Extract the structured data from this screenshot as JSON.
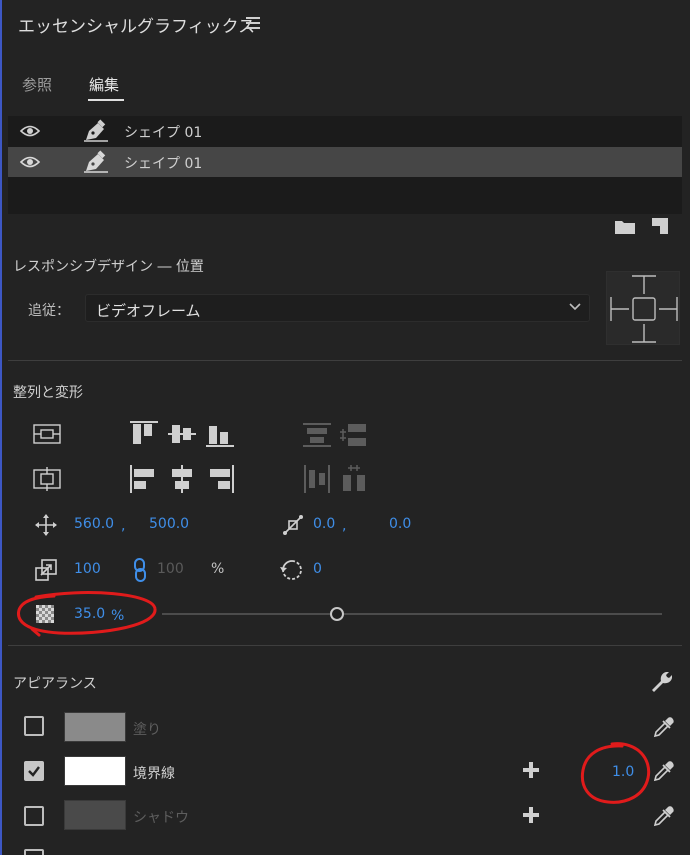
{
  "panel": {
    "title": "エッセンシャルグラフィックス"
  },
  "tabs": [
    {
      "label": "参照"
    },
    {
      "label": "編集"
    }
  ],
  "layers": [
    {
      "name": "シェイプ 01"
    },
    {
      "name": "シェイプ 01"
    }
  ],
  "responsive": {
    "heading": "レスポンシブデザイン ― 位置",
    "pin_label": "追従：",
    "pin_value": "ビデオフレーム"
  },
  "align_transform": {
    "heading": "整列と変形",
    "position": {
      "x": "560.0",
      "y": "500.0",
      "sep": ","
    },
    "anchor": {
      "x": "0.0",
      "y": "0.0",
      "sep": ","
    },
    "scale": {
      "value": "100",
      "linked_value": "100",
      "unit": "%"
    },
    "rotation": "0",
    "opacity": {
      "value": "35.0",
      "unit": "%",
      "fraction": 0.35
    }
  },
  "appearance": {
    "heading": "アピアランス",
    "rows": [
      {
        "label": "塗り",
        "checked": false,
        "swatch": "#8a8a8a"
      },
      {
        "label": "境界線",
        "checked": true,
        "swatch": "#ffffff",
        "width": "1.0"
      },
      {
        "label": "シャドウ",
        "checked": false,
        "swatch": "#4a4a4a"
      }
    ]
  },
  "colors": {
    "accent": "#3f8ee8",
    "annotation": "#e01b1b"
  }
}
